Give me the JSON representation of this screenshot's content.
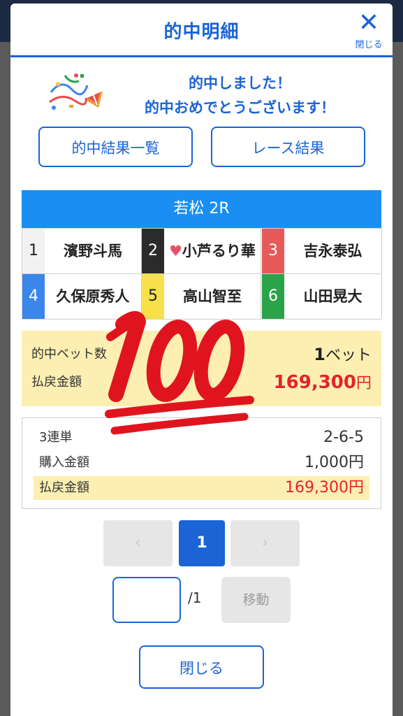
{
  "modal": {
    "title": "的中明細",
    "close_icon_label": "閉じる"
  },
  "congrats": {
    "line1": "的中しました！",
    "line2": "的中おめでとうございます！"
  },
  "buttons": {
    "hit_list": "的中結果一覧",
    "race_result": "レース結果",
    "close": "閉じる",
    "move": "移動"
  },
  "race": {
    "header": "若松 2R",
    "racers": [
      {
        "num": "1",
        "name": "濱野斗馬",
        "color": "#f2f2f2",
        "text_color": "#222222"
      },
      {
        "num": "2",
        "name": "小芦るり華",
        "color": "#2b2b2b",
        "text_color": "#ffffff",
        "heart": "♥"
      },
      {
        "num": "3",
        "name": "吉永泰弘",
        "color": "#e85a5a",
        "text_color": "#ffffff"
      },
      {
        "num": "4",
        "name": "久保原秀人",
        "color": "#3a86ea",
        "text_color": "#ffffff"
      },
      {
        "num": "5",
        "name": "高山智至",
        "color": "#f7e04a",
        "text_color": "#222222"
      },
      {
        "num": "6",
        "name": "山田晃大",
        "color": "#2aa34a",
        "text_color": "#ffffff"
      }
    ]
  },
  "summary": {
    "bets_label": "的中ベット数",
    "bets_count": "1",
    "bets_unit": "ベット",
    "payout_label": "払戻金額",
    "payout_value": "169,300",
    "yen": "円"
  },
  "detail": {
    "type_label": "3連単",
    "type_value": "2-6-5",
    "purchase_label": "購入金額",
    "purchase_value": "1,000円",
    "payout_label": "払戻金額",
    "payout_value": "169,300円"
  },
  "pagination": {
    "prev": "‹",
    "current": "1",
    "next": "›",
    "total": "/1"
  },
  "stamp": {
    "text": "100",
    "color": "#e0141e"
  },
  "colors": {
    "accent": "#1a64d6",
    "race_header": "#1a8ef2",
    "highlight": "#fdefb2",
    "payout_red": "#e4232a"
  }
}
